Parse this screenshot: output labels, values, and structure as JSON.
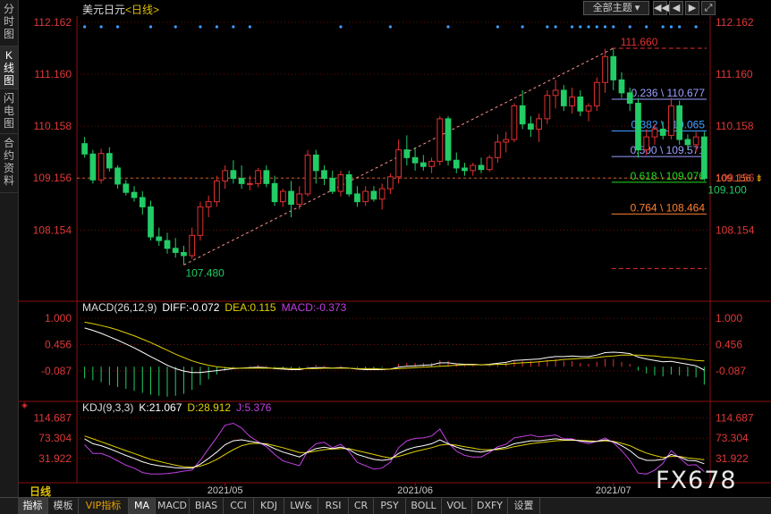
{
  "sidebar": {
    "tabs": [
      {
        "label": "分时图",
        "active": false
      },
      {
        "label": "K线图",
        "active": true
      },
      {
        "label": "闪电图",
        "active": false
      },
      {
        "label": "合约资料",
        "active": false
      }
    ]
  },
  "header": {
    "instrument": "美元日元",
    "period_tag": "<日线>",
    "theme_button": "全部主题",
    "icon_buttons": [
      "rewind-icon",
      "back-icon",
      "forward-icon",
      "fullscreen-icon"
    ]
  },
  "period_label": "日线",
  "bottom_tabs": [
    {
      "label": "指标",
      "active": true
    },
    {
      "label": "模板",
      "active": false
    },
    {
      "label": "VIP指标",
      "active": false,
      "vip": true
    },
    {
      "label": "MA",
      "active": true
    },
    {
      "label": "MACD",
      "active": false
    },
    {
      "label": "BIAS",
      "active": false
    },
    {
      "label": "CCI",
      "active": false
    },
    {
      "label": "KDJ",
      "active": false
    },
    {
      "label": "LW&",
      "active": false
    },
    {
      "label": "RSI",
      "active": false
    },
    {
      "label": "CR",
      "active": false
    },
    {
      "label": "PSY",
      "active": false
    },
    {
      "label": "BOLL",
      "active": false
    },
    {
      "label": "VOL",
      "active": false
    },
    {
      "label": "DXFY",
      "active": false
    },
    {
      "label": "设置",
      "active": false
    }
  ],
  "watermark": "FX678",
  "colors": {
    "up": "#e53030",
    "down": "#22cc66",
    "grid": "#8a1010",
    "axis_text": "#e03838",
    "diff": "#ffffff",
    "dea": "#e0d000",
    "macd": "#c040e0",
    "k_line": "#ffffff",
    "d_line": "#e0d000",
    "j_line": "#c040e0"
  },
  "chart_data": [
    {
      "type": "candlestick",
      "title": "美元日元<日线>",
      "y_ticks": [
        "112.162",
        "111.160",
        "110.158",
        "109.156",
        "108.154"
      ],
      "ylim": [
        106.9,
        112.35
      ],
      "x_ticks": [
        "2021/05",
        "2021/06",
        "2021/07"
      ],
      "current_price_label": "109.156",
      "high_label": "111.660",
      "low_label": "107.480",
      "last_low_label": "109.100",
      "fibonacci": [
        {
          "label": "0.236 \\ 110.677",
          "value": 110.677,
          "color": "#9aa0ff"
        },
        {
          "label": "0.382 \\ 110.065",
          "value": 110.065,
          "color": "#3fa0ff"
        },
        {
          "label": "0.500 \\ 109.571",
          "value": 109.571,
          "color": "#9aa0ff"
        },
        {
          "label": "0.618 \\ 109.076",
          "value": 109.076,
          "color": "#22dd22"
        },
        {
          "label": "0.764 \\ 108.464",
          "value": 108.464,
          "color": "#ff8030"
        }
      ],
      "fib_top": 111.66,
      "fib_bottom": 107.48,
      "candles": [
        [
          109.82,
          109.95,
          109.55,
          109.62
        ],
        [
          109.62,
          109.7,
          109.05,
          109.12
        ],
        [
          109.12,
          109.72,
          109.05,
          109.63
        ],
        [
          109.63,
          109.75,
          109.28,
          109.35
        ],
        [
          109.35,
          109.4,
          108.95,
          109.04
        ],
        [
          109.04,
          109.12,
          108.82,
          108.88
        ],
        [
          108.88,
          109.0,
          108.7,
          108.78
        ],
        [
          108.78,
          108.9,
          108.45,
          108.6
        ],
        [
          108.6,
          108.72,
          107.95,
          108.02
        ],
        [
          108.02,
          108.2,
          107.85,
          107.95
        ],
        [
          107.95,
          108.1,
          107.7,
          107.8
        ],
        [
          107.8,
          108.0,
          107.62,
          107.72
        ],
        [
          107.72,
          107.85,
          107.48,
          107.66
        ],
        [
          107.66,
          108.2,
          107.6,
          108.05
        ],
        [
          108.05,
          108.7,
          107.95,
          108.6
        ],
        [
          108.6,
          108.82,
          108.4,
          108.7
        ],
        [
          108.7,
          109.2,
          108.6,
          109.1
        ],
        [
          109.1,
          109.4,
          108.95,
          109.3
        ],
        [
          109.3,
          109.5,
          109.05,
          109.15
        ],
        [
          109.15,
          109.4,
          108.95,
          109.05
        ],
        [
          109.05,
          109.2,
          108.92,
          109.05
        ],
        [
          109.05,
          109.35,
          108.98,
          109.3
        ],
        [
          109.3,
          109.4,
          108.98,
          109.05
        ],
        [
          109.05,
          109.2,
          108.62,
          108.7
        ],
        [
          108.7,
          108.95,
          108.6,
          108.9
        ],
        [
          108.9,
          109.1,
          108.4,
          108.65
        ],
        [
          108.65,
          109.0,
          108.55,
          108.85
        ],
        [
          108.85,
          109.7,
          108.8,
          109.6
        ],
        [
          109.6,
          109.7,
          109.05,
          109.3
        ],
        [
          109.3,
          109.4,
          109.02,
          109.15
        ],
        [
          109.15,
          109.3,
          108.85,
          108.9
        ],
        [
          108.9,
          109.3,
          108.8,
          109.22
        ],
        [
          109.22,
          109.3,
          108.8,
          108.85
        ],
        [
          108.85,
          109.0,
          108.6,
          108.7
        ],
        [
          108.7,
          109.0,
          108.62,
          108.9
        ],
        [
          108.9,
          109.0,
          108.7,
          108.75
        ],
        [
          108.75,
          109.05,
          108.55,
          108.95
        ],
        [
          108.95,
          109.25,
          108.85,
          109.18
        ],
        [
          109.18,
          109.9,
          109.05,
          109.7
        ],
        [
          109.7,
          109.98,
          109.4,
          109.55
        ],
        [
          109.55,
          109.75,
          109.3,
          109.45
        ],
        [
          109.45,
          109.6,
          109.3,
          109.38
        ],
        [
          109.38,
          109.55,
          109.25,
          109.48
        ],
        [
          109.48,
          110.35,
          109.4,
          110.3
        ],
        [
          110.3,
          110.35,
          109.4,
          109.5
        ],
        [
          109.5,
          109.65,
          109.25,
          109.35
        ],
        [
          109.35,
          109.45,
          109.2,
          109.3
        ],
        [
          109.3,
          109.45,
          109.2,
          109.4
        ],
        [
          109.4,
          109.55,
          109.25,
          109.32
        ],
        [
          109.32,
          109.6,
          109.28,
          109.55
        ],
        [
          109.55,
          110.0,
          109.45,
          109.85
        ],
        [
          109.85,
          110.05,
          109.65,
          109.9
        ],
        [
          109.9,
          110.6,
          109.85,
          110.55
        ],
        [
          110.55,
          110.85,
          110.1,
          110.2
        ],
        [
          110.2,
          110.35,
          109.95,
          110.1
        ],
        [
          110.1,
          110.4,
          109.85,
          110.3
        ],
        [
          110.3,
          110.85,
          110.2,
          110.75
        ],
        [
          110.75,
          111.05,
          110.5,
          110.85
        ],
        [
          110.85,
          110.95,
          110.45,
          110.55
        ],
        [
          110.55,
          110.9,
          110.4,
          110.72
        ],
        [
          110.72,
          110.85,
          110.35,
          110.45
        ],
        [
          110.45,
          110.6,
          110.25,
          110.55
        ],
        [
          110.55,
          111.1,
          110.45,
          111.0
        ],
        [
          111.0,
          111.65,
          110.8,
          111.5
        ],
        [
          111.5,
          111.66,
          110.85,
          111.05
        ],
        [
          111.05,
          111.2,
          110.7,
          110.8
        ],
        [
          110.8,
          110.9,
          110.45,
          110.6
        ],
        [
          110.6,
          110.7,
          109.55,
          109.7
        ],
        [
          109.7,
          110.1,
          109.6,
          109.95
        ],
        [
          109.95,
          110.2,
          109.8,
          110.1
        ],
        [
          110.1,
          110.25,
          109.9,
          109.98
        ],
        [
          109.98,
          110.7,
          109.9,
          110.55
        ],
        [
          110.55,
          110.65,
          109.8,
          109.9
        ],
        [
          109.9,
          110.0,
          109.7,
          109.8
        ],
        [
          109.8,
          110.05,
          109.65,
          109.95
        ],
        [
          109.95,
          110.05,
          109.1,
          109.15
        ]
      ]
    },
    {
      "type": "line",
      "title": "MACD(26,12,9)",
      "legend": [
        {
          "text": "MACD(26,12,9)",
          "color": "#dddddd"
        },
        {
          "text": "DIFF:-0.072",
          "color": "#ffffff"
        },
        {
          "text": "DEA:0.115",
          "color": "#e0d000"
        },
        {
          "text": "MACD:-0.373",
          "color": "#c040e0"
        }
      ],
      "y_ticks": [
        "1.000",
        "0.456",
        "-0.087"
      ],
      "ylim": [
        -0.55,
        1.15
      ],
      "diff": [
        0.8,
        0.75,
        0.69,
        0.62,
        0.55,
        0.47,
        0.39,
        0.3,
        0.21,
        0.12,
        0.03,
        -0.04,
        -0.09,
        -0.12,
        -0.12,
        -0.1,
        -0.08,
        -0.06,
        -0.04,
        -0.03,
        -0.02,
        -0.01,
        -0.02,
        -0.04,
        -0.05,
        -0.06,
        -0.06,
        -0.03,
        -0.02,
        -0.02,
        -0.03,
        -0.02,
        -0.03,
        -0.05,
        -0.06,
        -0.06,
        -0.06,
        -0.05,
        -0.01,
        0.01,
        0.02,
        0.03,
        0.04,
        0.08,
        0.08,
        0.06,
        0.05,
        0.05,
        0.04,
        0.05,
        0.07,
        0.09,
        0.13,
        0.14,
        0.15,
        0.16,
        0.19,
        0.21,
        0.21,
        0.22,
        0.21,
        0.21,
        0.24,
        0.29,
        0.3,
        0.29,
        0.27,
        0.2,
        0.16,
        0.13,
        0.1,
        0.11,
        0.08,
        0.05,
        0.02,
        -0.07
      ],
      "dea": [
        0.92,
        0.89,
        0.85,
        0.81,
        0.76,
        0.7,
        0.64,
        0.57,
        0.5,
        0.42,
        0.34,
        0.26,
        0.19,
        0.12,
        0.07,
        0.03,
        0.0,
        -0.02,
        -0.03,
        -0.03,
        -0.03,
        -0.03,
        -0.03,
        -0.03,
        -0.03,
        -0.04,
        -0.04,
        -0.04,
        -0.04,
        -0.03,
        -0.03,
        -0.03,
        -0.03,
        -0.04,
        -0.04,
        -0.04,
        -0.05,
        -0.05,
        -0.04,
        -0.03,
        -0.02,
        -0.01,
        0.0,
        0.01,
        0.02,
        0.03,
        0.04,
        0.04,
        0.04,
        0.04,
        0.05,
        0.05,
        0.07,
        0.08,
        0.09,
        0.1,
        0.12,
        0.13,
        0.15,
        0.16,
        0.17,
        0.18,
        0.19,
        0.21,
        0.22,
        0.24,
        0.24,
        0.24,
        0.23,
        0.22,
        0.2,
        0.19,
        0.17,
        0.15,
        0.13,
        0.12
      ],
      "macd": [
        -0.24,
        -0.28,
        -0.32,
        -0.38,
        -0.42,
        -0.46,
        -0.5,
        -0.54,
        -0.58,
        -0.6,
        -0.62,
        -0.6,
        -0.56,
        -0.48,
        -0.38,
        -0.26,
        -0.16,
        -0.08,
        -0.02,
        0.0,
        0.02,
        0.04,
        0.02,
        -0.02,
        -0.04,
        -0.04,
        -0.04,
        0.02,
        0.04,
        0.02,
        0.0,
        0.02,
        0.0,
        -0.02,
        -0.04,
        -0.04,
        -0.02,
        0.0,
        0.06,
        0.08,
        0.08,
        0.08,
        0.08,
        0.14,
        0.12,
        0.06,
        0.02,
        0.02,
        0.0,
        0.02,
        0.04,
        0.08,
        0.12,
        0.12,
        0.12,
        0.12,
        0.14,
        0.16,
        0.12,
        0.12,
        0.08,
        0.06,
        0.1,
        0.16,
        0.16,
        0.1,
        0.06,
        -0.08,
        -0.14,
        -0.18,
        -0.2,
        -0.16,
        -0.18,
        -0.2,
        -0.22,
        -0.37
      ]
    },
    {
      "type": "line",
      "title": "KDJ(9,3,3)",
      "legend": [
        {
          "text": "KDJ(9,3,3)",
          "color": "#dddddd"
        },
        {
          "text": "K:21.067",
          "color": "#ffffff"
        },
        {
          "text": "D:28.912",
          "color": "#e0d000"
        },
        {
          "text": "J:5.376",
          "color": "#c040e0"
        }
      ],
      "y_ticks": [
        "114.687",
        "73.304",
        "31.922"
      ],
      "ylim": [
        -5,
        125
      ],
      "k": [
        72,
        62,
        58,
        52,
        45,
        38,
        32,
        25,
        20,
        17,
        15,
        13,
        12,
        12,
        20,
        32,
        45,
        60,
        68,
        70,
        67,
        64,
        60,
        52,
        45,
        40,
        35,
        45,
        52,
        55,
        52,
        55,
        50,
        40,
        35,
        30,
        28,
        30,
        42,
        50,
        55,
        58,
        62,
        70,
        62,
        55,
        50,
        47,
        45,
        48,
        52,
        55,
        62,
        65,
        68,
        68,
        70,
        72,
        70,
        70,
        68,
        66,
        67,
        70,
        66,
        58,
        48,
        34,
        28,
        28,
        30,
        40,
        35,
        28,
        27,
        21
      ],
      "d": [
        78,
        72,
        66,
        60,
        54,
        48,
        42,
        36,
        30,
        26,
        22,
        18,
        15,
        14,
        16,
        22,
        30,
        40,
        50,
        58,
        62,
        63,
        62,
        58,
        54,
        49,
        44,
        44,
        47,
        50,
        51,
        52,
        52,
        48,
        44,
        40,
        36,
        33,
        36,
        41,
        46,
        50,
        54,
        59,
        61,
        59,
        56,
        53,
        50,
        50,
        50,
        52,
        56,
        59,
        62,
        64,
        66,
        68,
        69,
        69,
        69,
        68,
        67,
        68,
        67,
        63,
        58,
        50,
        43,
        38,
        34,
        36,
        36,
        33,
        31,
        29
      ],
      "j": [
        60,
        42,
        42,
        36,
        27,
        18,
        12,
        3,
        0,
        0,
        1,
        3,
        6,
        8,
        28,
        52,
        75,
        100,
        104,
        94,
        77,
        66,
        56,
        40,
        27,
        22,
        17,
        47,
        62,
        65,
        54,
        61,
        46,
        24,
        17,
        10,
        12,
        24,
        54,
        68,
        73,
        74,
        78,
        92,
        64,
        47,
        38,
        35,
        35,
        44,
        56,
        61,
        74,
        77,
        80,
        76,
        78,
        80,
        72,
        72,
        66,
        62,
        67,
        74,
        64,
        48,
        28,
        2,
        0,
        8,
        22,
        48,
        33,
        18,
        19,
        5
      ]
    }
  ]
}
